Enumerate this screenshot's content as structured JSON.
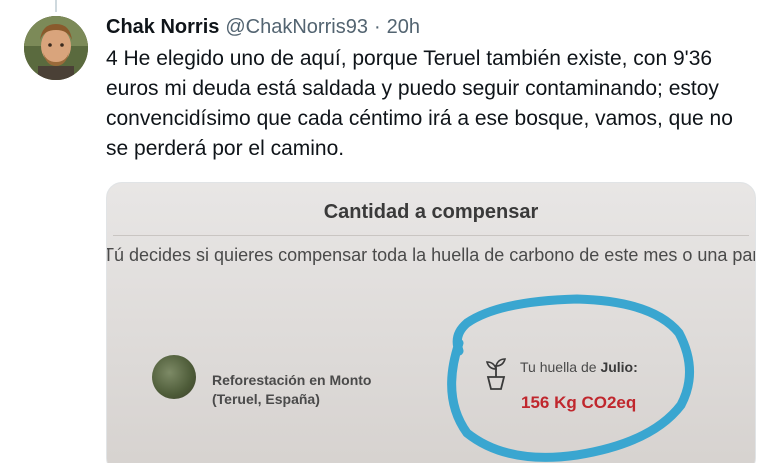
{
  "tweet": {
    "display_name": "Chak Norris",
    "handle": "@ChakNorris93",
    "separator": "·",
    "time": "20h",
    "text": "4 He elegido uno de aquí, porque Teruel también existe, con 9'36 euros mi deuda está saldada y puedo seguir contaminando; estoy convencidísimo que cada céntimo irá a ese bosque, vamos, que no se perderá por el camino."
  },
  "media": {
    "dialog_title": "Cantidad a compensar",
    "dialog_description": "Tú decides si quieres compensar toda la huella de carbono de este mes o una parte de",
    "project_name_line1": "Reforestación en Monto",
    "project_name_line2": "(Teruel, España)",
    "footprint_label": "Tu huella de",
    "footprint_month": "Julio:",
    "footprint_value": "156 Kg CO2eq",
    "footprint_icon": "plant-pot-icon",
    "highlight_color": "#3aa6d0",
    "value_color": "#c0272d"
  },
  "colors": {
    "text_primary": "#0f1419",
    "text_secondary": "#536471"
  }
}
